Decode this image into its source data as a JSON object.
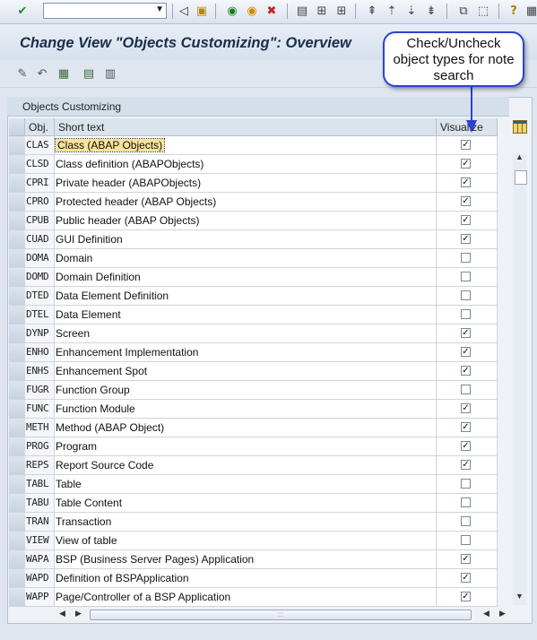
{
  "toolbar": {
    "command_field": "",
    "icons": [
      "enter-icon",
      "back-icon",
      "save-icon",
      "back-nav-icon",
      "exit-icon",
      "cancel-icon",
      "print-icon",
      "find-icon",
      "find-next-icon",
      "first-page-icon",
      "prev-page-icon",
      "next-page-icon",
      "last-page-icon",
      "create-session-icon",
      "shortcut-icon",
      "help-icon",
      "layout-menu-icon"
    ]
  },
  "title": "Change View \"Objects Customizing\": Overview",
  "app_toolbar": {
    "icons": [
      "change-display-icon",
      "undo-icon",
      "select-all-icon",
      "select-block-icon",
      "deselect-all-icon"
    ]
  },
  "callout": {
    "text_line1": "Check/Uncheck",
    "text_line2": "object types for note",
    "text_line3": "search"
  },
  "table": {
    "caption": "Objects Customizing",
    "columns": {
      "obj": "Obj.",
      "short_text": "Short text",
      "visualize": "Visualize"
    },
    "rows": [
      {
        "obj": "CLAS",
        "text": "Class (ABAP Objects)",
        "visualize": true
      },
      {
        "obj": "CLSD",
        "text": "Class definition (ABAPObjects)",
        "visualize": true
      },
      {
        "obj": "CPRI",
        "text": "Private header (ABAPObjects)",
        "visualize": true
      },
      {
        "obj": "CPRO",
        "text": "Protected header (ABAP Objects)",
        "visualize": true
      },
      {
        "obj": "CPUB",
        "text": "Public header (ABAP Objects)",
        "visualize": true
      },
      {
        "obj": "CUAD",
        "text": "GUI Definition",
        "visualize": true
      },
      {
        "obj": "DOMA",
        "text": "Domain",
        "visualize": false
      },
      {
        "obj": "DOMD",
        "text": "Domain Definition",
        "visualize": false
      },
      {
        "obj": "DTED",
        "text": "Data Element Definition",
        "visualize": false
      },
      {
        "obj": "DTEL",
        "text": "Data Element",
        "visualize": false
      },
      {
        "obj": "DYNP",
        "text": "Screen",
        "visualize": true
      },
      {
        "obj": "ENHO",
        "text": "Enhancement Implementation",
        "visualize": true
      },
      {
        "obj": "ENHS",
        "text": "Enhancement Spot",
        "visualize": true
      },
      {
        "obj": "FUGR",
        "text": "Function Group",
        "visualize": false
      },
      {
        "obj": "FUNC",
        "text": "Function Module",
        "visualize": true
      },
      {
        "obj": "METH",
        "text": "Method (ABAP Object)",
        "visualize": true
      },
      {
        "obj": "PROG",
        "text": "Program",
        "visualize": true
      },
      {
        "obj": "REPS",
        "text": "Report Source Code",
        "visualize": true
      },
      {
        "obj": "TABL",
        "text": "Table",
        "visualize": false
      },
      {
        "obj": "TABU",
        "text": "Table Content",
        "visualize": false
      },
      {
        "obj": "TRAN",
        "text": "Transaction",
        "visualize": false
      },
      {
        "obj": "VIEW",
        "text": "View of table",
        "visualize": false
      },
      {
        "obj": "WAPA",
        "text": "BSP (Business Server Pages) Application",
        "visualize": true
      },
      {
        "obj": "WAPD",
        "text": "Definition of BSPApplication",
        "visualize": true
      },
      {
        "obj": "WAPP",
        "text": "Page/Controller of a BSP Application",
        "visualize": true
      }
    ]
  },
  "colors": {
    "title_text": "#1b2d4a",
    "callout_border": "#2b43d6",
    "focus_highlight": "#f7e39b"
  }
}
